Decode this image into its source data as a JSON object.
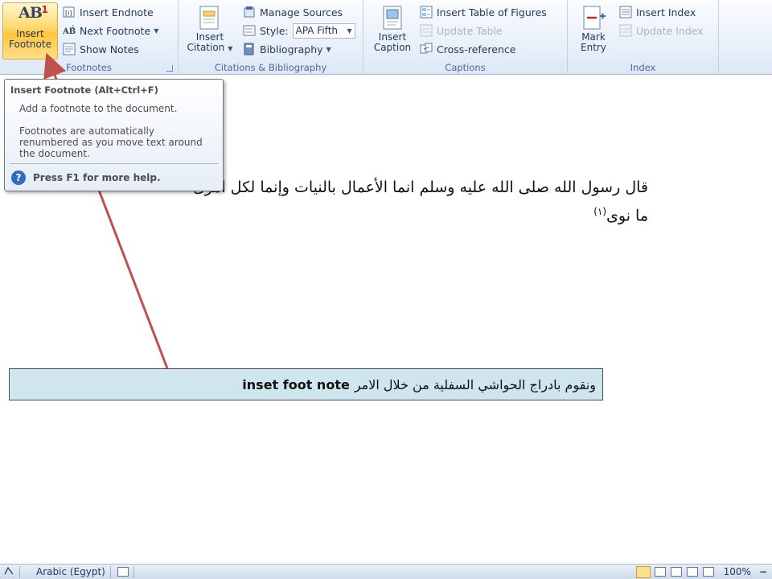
{
  "ribbon": {
    "footnotes": {
      "insert_footnote_line1": "Insert",
      "insert_footnote_line2": "Footnote",
      "insert_endnote": "Insert Endnote",
      "next_footnote": "Next Footnote",
      "show_notes": "Show Notes",
      "group_label": "Footnotes"
    },
    "citations": {
      "insert_citation_line1": "Insert",
      "insert_citation_line2": "Citation",
      "manage_sources": "Manage Sources",
      "style_label": "Style:",
      "style_value": "APA Fifth",
      "bibliography": "Bibliography",
      "group_label": "Citations & Bibliography"
    },
    "captions": {
      "insert_caption_line1": "Insert",
      "insert_caption_line2": "Caption",
      "insert_table_of_figures": "Insert Table of Figures",
      "update_table": "Update Table",
      "cross_reference": "Cross-reference",
      "group_label": "Captions"
    },
    "index": {
      "mark_entry_line1": "Mark",
      "mark_entry_line2": "Entry",
      "insert_index": "Insert Index",
      "update_index": "Update Index",
      "group_label": "Index"
    }
  },
  "tooltip": {
    "title": "Insert Footnote (Alt+Ctrl+F)",
    "description": "Add a footnote to the document.",
    "details": "Footnotes are automatically renumbered as you move text around the document.",
    "help": "Press F1 for more help."
  },
  "document": {
    "line1": "قال رسول الله صلى الله عليه وسلم  انما الأعمال بالنيات وإنما لكل امرئ",
    "line2": "ما نوى",
    "footnote_ref": "(١)"
  },
  "callout": {
    "arabic_text": "ونقوم بادراج الحواشي السفلية من خلال الامر",
    "english_text": "inset foot note"
  },
  "statusbar": {
    "language": "Arabic (Egypt)",
    "zoom": "100%"
  },
  "colors": {
    "ribbon_bg": "#e6eef8",
    "active_button": "#ffd86b",
    "callout_bg": "#cfe6ee",
    "arrow": "#c0504d"
  }
}
